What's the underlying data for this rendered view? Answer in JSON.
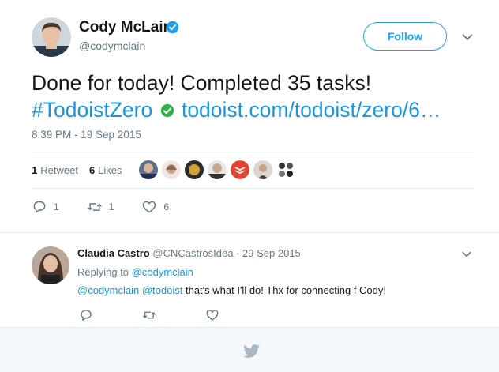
{
  "tweet": {
    "author_name": "Cody McLain",
    "author_handle": "@codymclain",
    "follow_label": "Follow",
    "text_line1": "Done for today! Completed 35 tasks!",
    "hashtag": "#TodoistZero",
    "link_text": "todoist.com/todoist/zero/6…",
    "timestamp": "8:39 PM - 19 Sep 2015",
    "retweet_count": "1",
    "retweet_label": "Retweet",
    "like_count": "6",
    "like_label": "Likes",
    "actions": {
      "reply_count": "1",
      "retweet_count": "1",
      "like_count": "6"
    },
    "liker_avatars": [
      "avatar-1",
      "avatar-2",
      "avatar-3",
      "avatar-4",
      "todoist-logo-avatar",
      "avatar-6",
      "avatar-7"
    ],
    "colors": {
      "accent": "#1da1f2",
      "link": "#1b95e0",
      "verified": "#1da1f2",
      "check": "#2fb344"
    }
  },
  "reply": {
    "author_name": "Claudia Castro",
    "author_handle": "@CNCastrosIdea",
    "separator": "·",
    "date": "29 Sep 2015",
    "replying_prefix": "Replying to",
    "replying_to": "@codymclain",
    "mention1": "@codymclain",
    "mention2": "@todoist",
    "body": "that's what I'll do!  Thx for connecting f Cody!"
  },
  "footer": {
    "icon": "twitter-bird-icon"
  }
}
